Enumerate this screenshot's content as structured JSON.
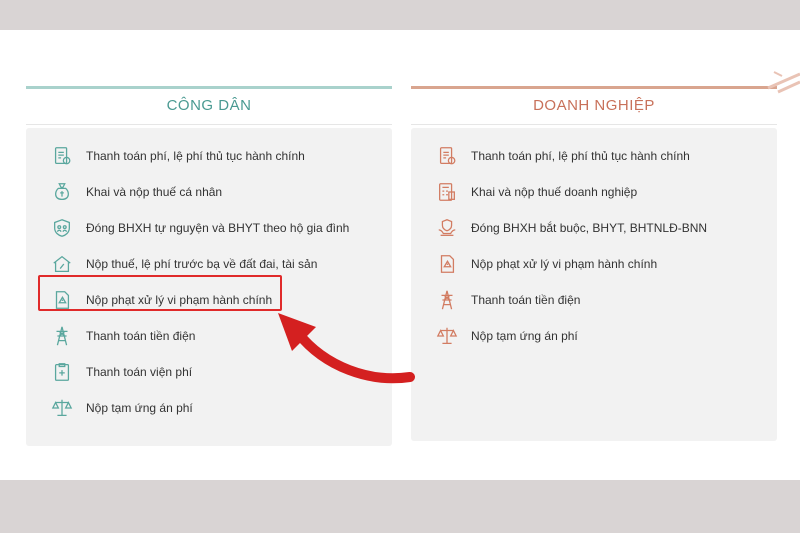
{
  "citizen": {
    "title": "CÔNG DÂN",
    "items": [
      {
        "label": "Thanh toán phí, lệ phí thủ tục hành chính",
        "icon": "document-fee-icon"
      },
      {
        "label": "Khai và nộp thuế cá nhân",
        "icon": "money-bag-icon"
      },
      {
        "label": "Đóng BHXH tự nguyện và BHYT theo hộ gia đình",
        "icon": "family-shield-icon"
      },
      {
        "label": "Nộp thuế, lệ phí trước bạ về đất đai, tài sản",
        "icon": "house-tax-icon"
      },
      {
        "label": "Nộp phạt xử lý vi phạm hành chính",
        "icon": "warning-document-icon"
      },
      {
        "label": "Thanh toán tiền điện",
        "icon": "power-tower-icon"
      },
      {
        "label": "Thanh toán viện phí",
        "icon": "hospital-bill-icon"
      },
      {
        "label": "Nộp tạm ứng án phí",
        "icon": "scales-icon"
      }
    ]
  },
  "business": {
    "title": "DOANH NGHIỆP",
    "items": [
      {
        "label": "Thanh toán phí, lệ phí thủ tục hành chính",
        "icon": "document-fee-icon"
      },
      {
        "label": "Khai và nộp thuế doanh nghiệp",
        "icon": "calculator-document-icon"
      },
      {
        "label": "Đóng BHXH bắt buộc, BHYT, BHTNLĐ-BNN",
        "icon": "hands-shield-icon"
      },
      {
        "label": "Nộp phạt xử lý vi phạm hành chính",
        "icon": "warning-document-icon"
      },
      {
        "label": "Thanh toán tiền điện",
        "icon": "power-tower-icon"
      },
      {
        "label": "Nộp tạm ứng án phí",
        "icon": "scales-icon"
      }
    ]
  },
  "colors": {
    "citizen_accent": "#4a9a92",
    "business_accent": "#c8715a",
    "highlight": "#e02a2a"
  }
}
